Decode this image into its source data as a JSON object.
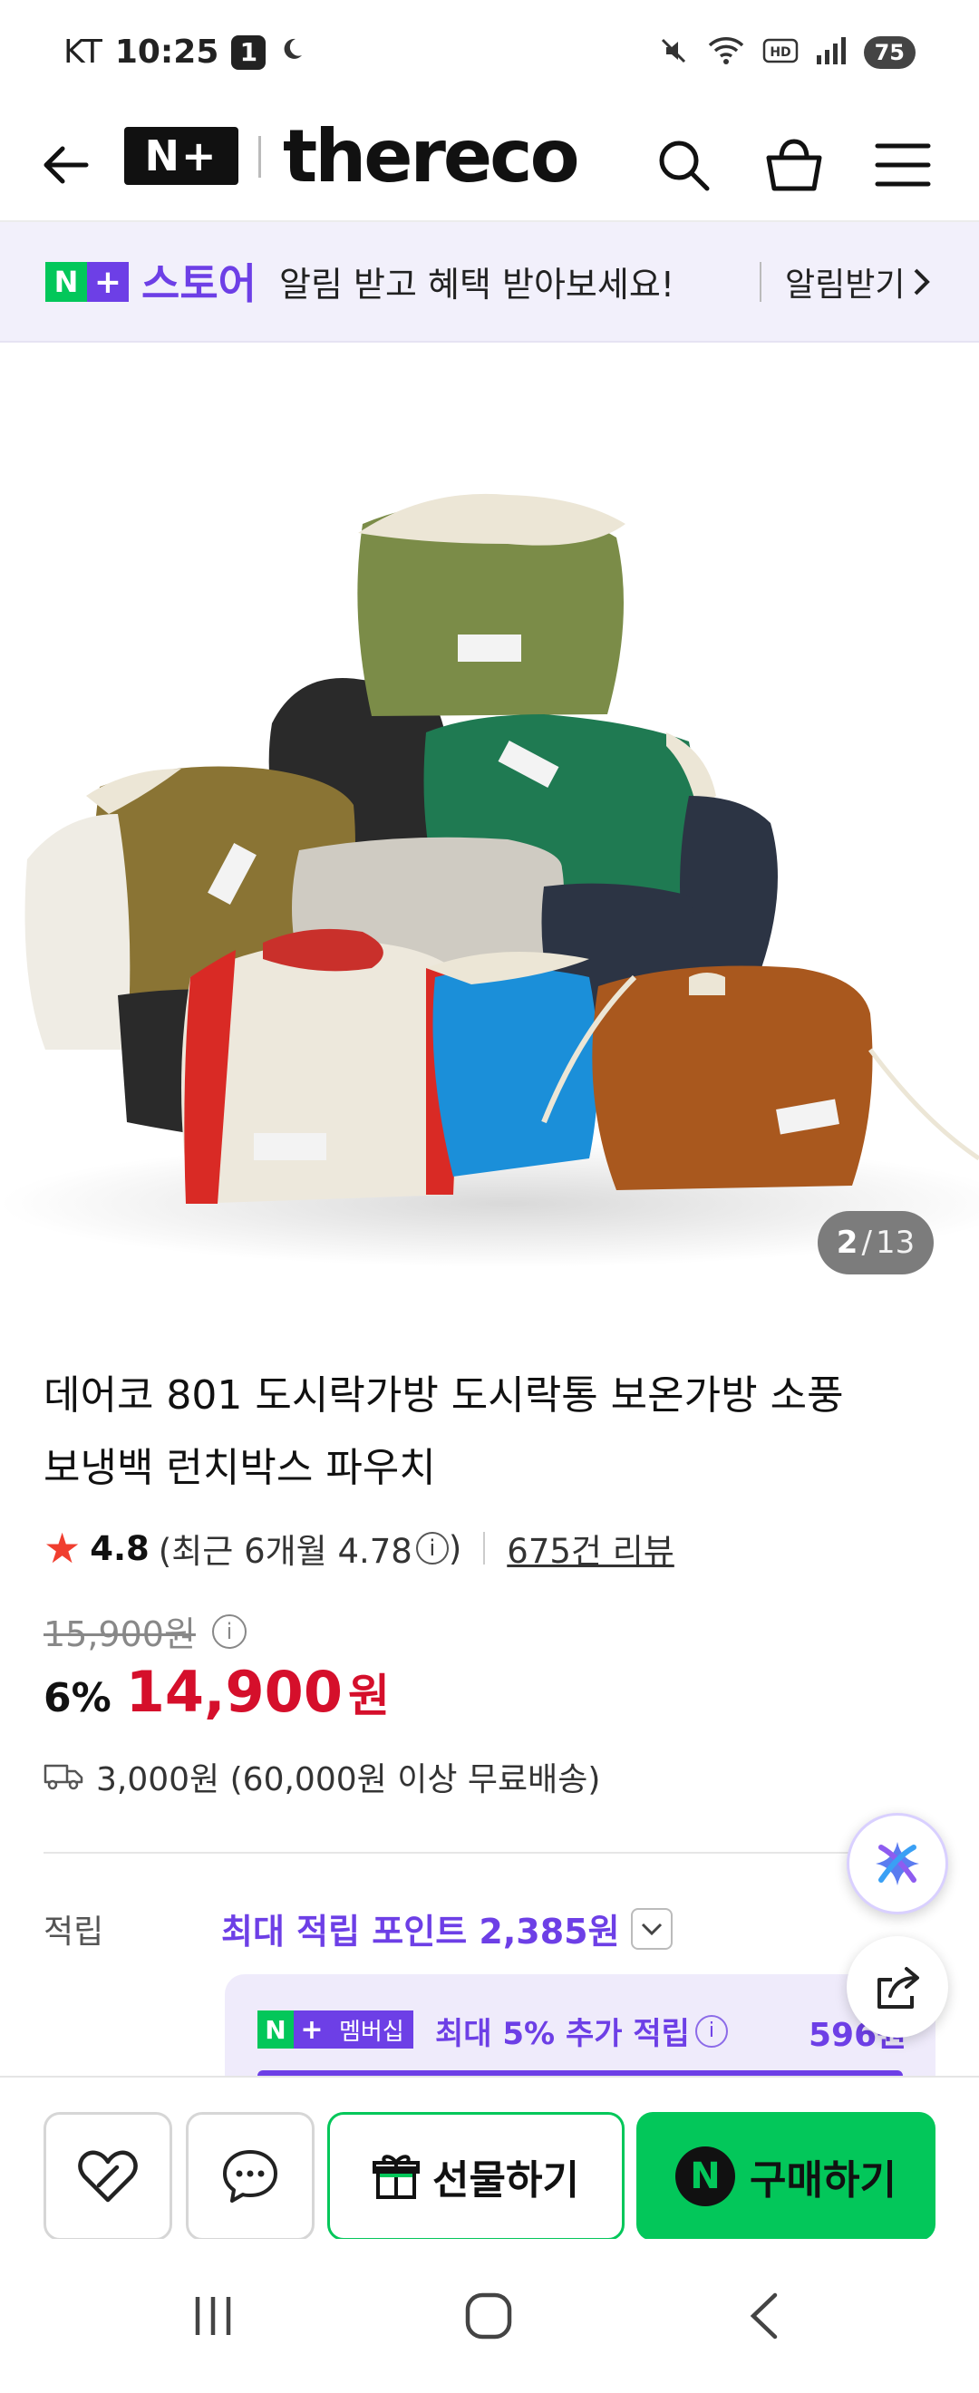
{
  "status_bar": {
    "carrier": "KT",
    "time": "10:25",
    "notification_count": "1",
    "battery": "75"
  },
  "header": {
    "brand_name": "thereco",
    "npluss_label": "N+"
  },
  "promo": {
    "store_label": "스토어",
    "message": "알림 받고 혜택 받아보세요!",
    "action": "알림받기"
  },
  "gallery": {
    "current": "2",
    "separator": "/",
    "total": "13"
  },
  "product": {
    "title_line1": "데어코 801 도시락가방 도시락통 보온가방 소풍",
    "title_line2": "보냉백 런치박스 파우치",
    "rating": "4.8",
    "rating_recent_text": "(최근 6개월 4.78",
    "rating_recent_close": ")",
    "review_count": "675건 리뷰",
    "original_price": "15,900원",
    "discount": "6%",
    "sale_price": "14,900",
    "sale_unit": "원",
    "shipping": "3,000원 (60,000원 이상 무료배송)"
  },
  "points": {
    "label": "적립",
    "max_points": "최대 적립 포인트 2,385원",
    "membership_badge": "멤버십",
    "membership_text": "최대 5% 추가 적립",
    "membership_amount": "596원"
  },
  "actions": {
    "gift_label": "선물하기",
    "buy_label": "구매하기"
  },
  "colors": {
    "naver_green": "#03c75a",
    "naver_purple": "#6d3fe6",
    "price_red": "#d50f2b"
  }
}
